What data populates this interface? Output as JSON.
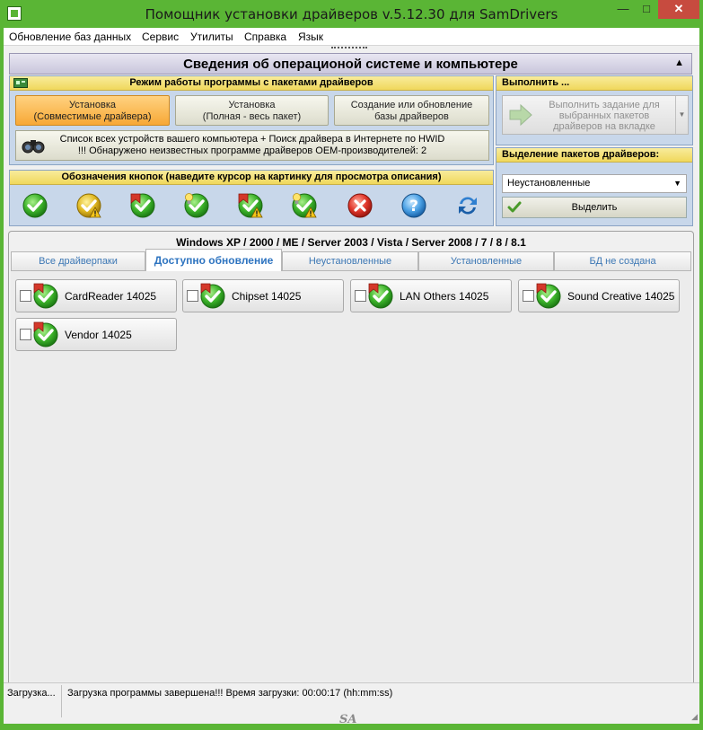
{
  "window": {
    "title": "Помощник установки драйверов v.5.12.30 для SamDrivers"
  },
  "menu": [
    {
      "label": "Обновление баз данных"
    },
    {
      "label": "Сервис"
    },
    {
      "label": "Утилиты"
    },
    {
      "label": "Справка"
    },
    {
      "label": "Язык"
    }
  ],
  "os_panel": {
    "title": "Сведения об операционой системе и компьютере"
  },
  "mode_panel": {
    "title": "Режим работы программы с пакетами драйверов",
    "buttons": [
      {
        "line1": "Установка",
        "line2": "(Совместимые драйвера)",
        "active": true
      },
      {
        "line1": "Установка",
        "line2": "(Полная - весь пакет)",
        "active": false
      },
      {
        "line1": "Создание или обновление",
        "line2": "базы драйверов",
        "active": false
      }
    ],
    "device_button": {
      "line1": "Список всех устройств вашего компьютера + Поиск драйвера в Интернете по HWID",
      "line2": "!!! Обнаружено неизвестных программе драйверов OEM-производителей: 2"
    }
  },
  "legend_panel": {
    "title": "Обозначения кнопок (наведите курсор на картинку для просмотра описания)",
    "icons": [
      "check-icon",
      "check-warning-yellow-icon",
      "check-bookmark-icon",
      "check-bulb-icon",
      "check-bookmark-warning-icon",
      "check-bulb-warning-icon",
      "error-x-icon",
      "help-icon",
      "refresh-icon"
    ]
  },
  "execute_panel": {
    "title": "Выполнить ...",
    "button": {
      "line1": "Выполнить задание для",
      "line2": "выбранных пакетов",
      "line3": "драйверов на вкладке"
    }
  },
  "select_panel": {
    "title": "Выделение пакетов драйверов:",
    "selected": "Неустановленные",
    "button": "Выделить"
  },
  "os_caption": "Windows XP / 2000 / ME / Server 2003 / Vista / Server 2008 / 7 / 8 / 8.1",
  "tabs": [
    {
      "label": "Все драйверпаки",
      "active": false
    },
    {
      "label": "Доступно обновление",
      "active": true
    },
    {
      "label": "Неустановленные",
      "active": false
    },
    {
      "label": "Установленные",
      "active": false
    },
    {
      "label": "БД не создана",
      "active": false
    }
  ],
  "drivers": [
    {
      "label": "CardReader 14025"
    },
    {
      "label": "Chipset 14025"
    },
    {
      "label": "LAN Others 14025"
    },
    {
      "label": "Sound Creative 14025"
    },
    {
      "label": "Vendor 14025"
    }
  ],
  "status": {
    "left": "Загрузка...",
    "message": "Загрузка программы завершена!!! Время загрузки: 00:00:17 (hh:mm:ss)",
    "logo": "SA"
  },
  "colors": {
    "title_bar": "#5ab535",
    "close_button": "#c74b3f",
    "panel_header": "#f0d85c",
    "active_mode": "#f7a836",
    "active_tab_text": "#2e74c0"
  }
}
